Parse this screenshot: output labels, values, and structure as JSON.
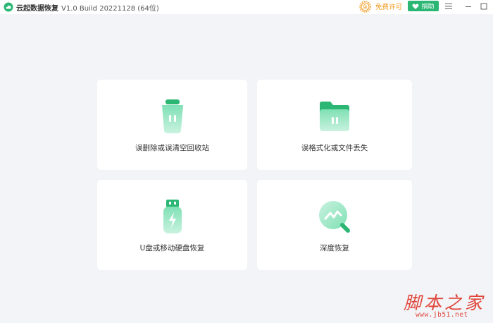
{
  "titlebar": {
    "app_name": "云起数据恢复",
    "version": "V1.0 Build 20221128 (64位)",
    "license_label": "免费许可",
    "license_badge": "免",
    "donate_label": "捐助",
    "icons": [
      "app-logo-icon",
      "license-icon",
      "heart-icon",
      "menu-icon",
      "minimize-icon",
      "maximize-icon"
    ]
  },
  "cards": [
    {
      "label": "误删除或误清空回收站",
      "icon": "trash-bin-icon"
    },
    {
      "label": "误格式化或文件丢失",
      "icon": "folder-icon"
    },
    {
      "label": "U盘或移动硬盘恢复",
      "icon": "usb-drive-icon"
    },
    {
      "label": "深度恢复",
      "icon": "deep-scan-icon"
    }
  ],
  "watermark": {
    "text_cn": "脚本之家",
    "url": "www.jb51.net"
  },
  "colors": {
    "accent": "#2bb673",
    "license": "#f29a1c",
    "background": "#f2f4f7",
    "watermark": "#e0463b"
  }
}
